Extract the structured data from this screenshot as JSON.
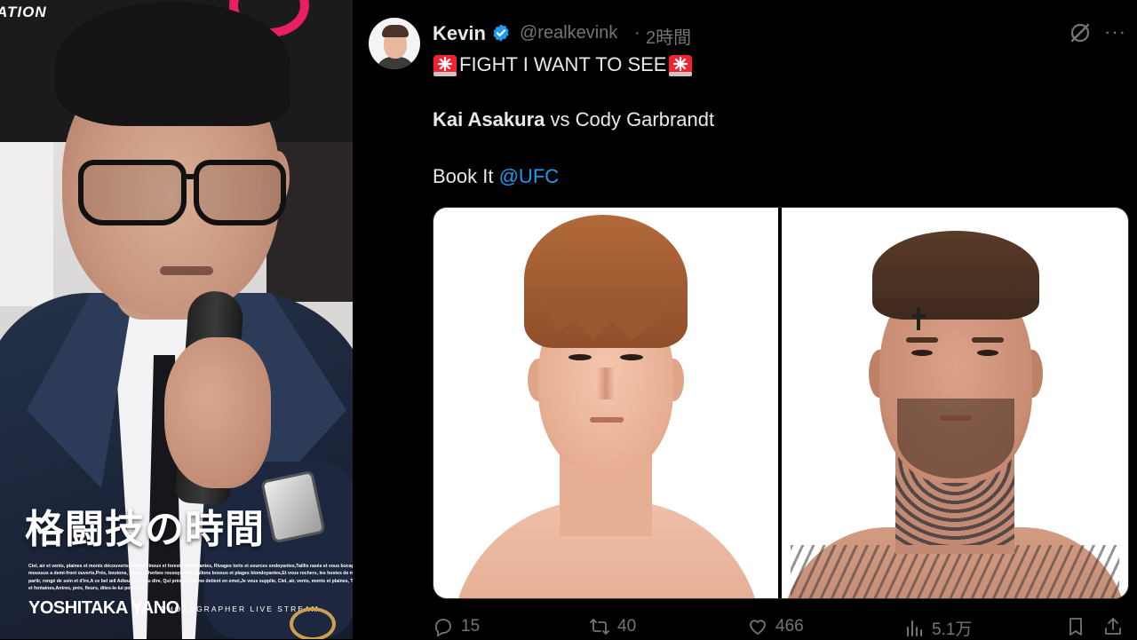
{
  "left_panel": {
    "banner_text": "ATION",
    "title": "格闘技の時間",
    "poem": "Ciel, air et vents, plaines et monts découverts,Tertres vineux et forests verdoyantes, Rivages torts et sources ondoyantes,Taillis rasés et vous bocages verts, Antres moussus a demi-front ouverts,Prés, boutons, fleurs et herbes rousoyantes, Vallons bossus et plages blondoyantes,Et vous rochers, les hostes de mes vers, Puis qu'au partir, rongé de soin et d'ire,A ce bel œil Adieu je n'ai su dire, Qui près et loin me detient en emoi,Je vous supplie, Ciel, air, vents, monts et plaines, Taillis, forests, rivages et fontaines,Antres, prés, fleurs, dites-le-lui pour moi.",
    "photographer_name": "YOSHITAKA YANO",
    "photographer_sub": "PHOTOGRAPHER LIVE STREAM"
  },
  "tweet": {
    "author_name": "Kevin",
    "handle": "@realkevink",
    "separator": "·",
    "time": "2時間",
    "line1": "FIGHT I WANT TO SEE",
    "fighter1": "Kai Asakura",
    "vs_text": " vs Cody Garbrandt",
    "line3_prefix": "Book It ",
    "mention": "@UFC",
    "more_glyph": "···",
    "stats": {
      "replies": "15",
      "retweets": "40",
      "likes": "466",
      "views": "5.1万"
    }
  },
  "colors": {
    "background": "#000000",
    "text": "#e7e9ea",
    "muted": "#71767b",
    "link": "#1d9bf0",
    "verified": "#1d9bf0",
    "siren": "#f4212e"
  },
  "icons": {
    "verified": "verified-badge-icon",
    "siren": "rotating-light-icon",
    "grok": "grok-icon",
    "more": "more-icon",
    "reply": "reply-icon",
    "retweet": "retweet-icon",
    "like": "heart-icon",
    "views": "views-icon",
    "bookmark": "bookmark-icon",
    "share": "share-icon"
  }
}
